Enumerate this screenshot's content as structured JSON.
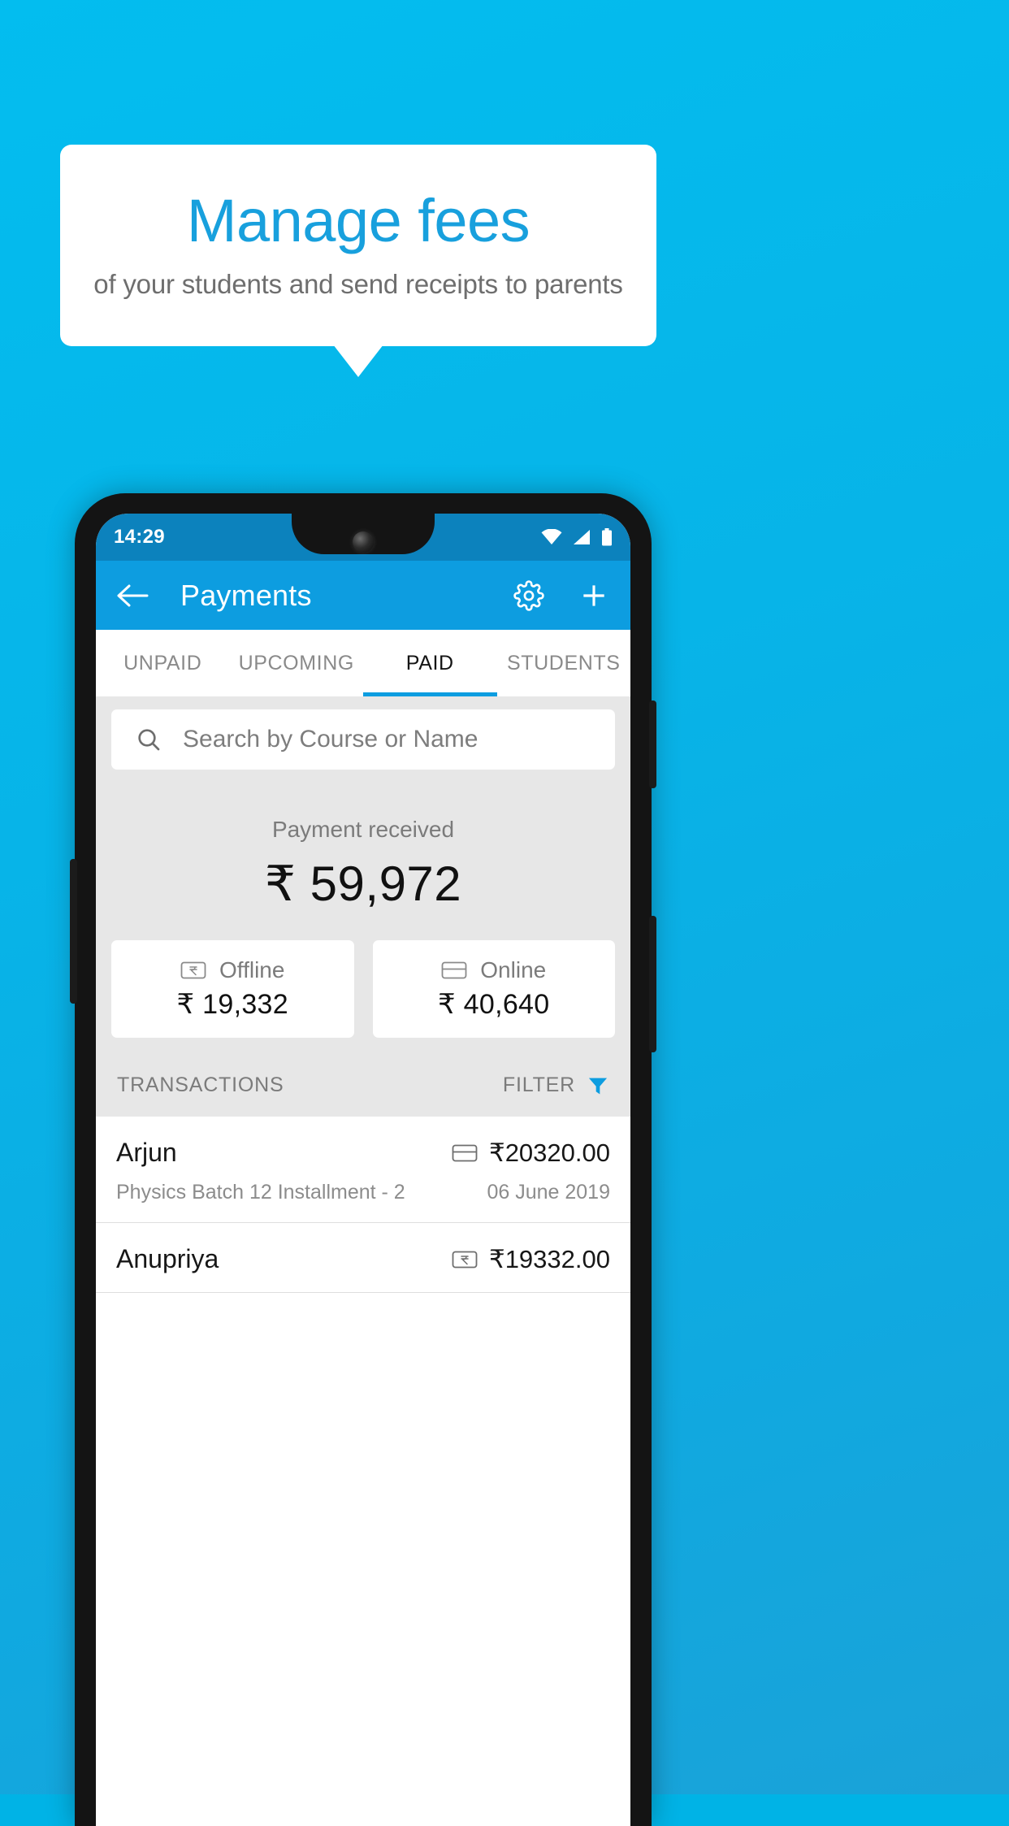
{
  "promo": {
    "headline": "Manage fees",
    "subhead": "of your students and send receipts to parents",
    "headline_color": "#18a0dd",
    "background_color": "#03bdef"
  },
  "phone": {
    "status_bar": {
      "time": "14:29",
      "icons": [
        "wifi-icon",
        "signal-icon",
        "battery-icon"
      ]
    },
    "app_bar": {
      "back_icon": "arrow-left-icon",
      "title": "Payments",
      "actions": [
        "gear-icon",
        "plus-icon"
      ],
      "color": "#0d9de0"
    },
    "tabs": [
      {
        "label": "UNPAID",
        "active": false
      },
      {
        "label": "UPCOMING",
        "active": false
      },
      {
        "label": "PAID",
        "active": true
      },
      {
        "label": "STUDENTS",
        "active": false
      }
    ],
    "search": {
      "icon": "search-icon",
      "placeholder": "Search by Course or Name",
      "value": ""
    },
    "summary": {
      "label": "Payment received",
      "amount": "₹ 59,972"
    },
    "payment_cards": [
      {
        "icon": "rupee-note-icon",
        "label": "Offline",
        "amount": "₹ 19,332"
      },
      {
        "icon": "credit-card-icon",
        "label": "Online",
        "amount": "₹ 40,640"
      }
    ],
    "transactions_header": {
      "title": "TRANSACTIONS",
      "filter_label": "FILTER",
      "filter_icon": "funnel-icon",
      "filter_color": "#0d9de0"
    },
    "transactions": [
      {
        "name": "Arjun",
        "description": "Physics Batch 12 Installment - 2",
        "amount": "₹20320.00",
        "date": "06 June 2019",
        "method_icon": "credit-card-icon"
      },
      {
        "name": "Anupriya",
        "description": "",
        "amount": "₹19332.00",
        "date": "",
        "method_icon": "rupee-note-icon"
      }
    ]
  }
}
